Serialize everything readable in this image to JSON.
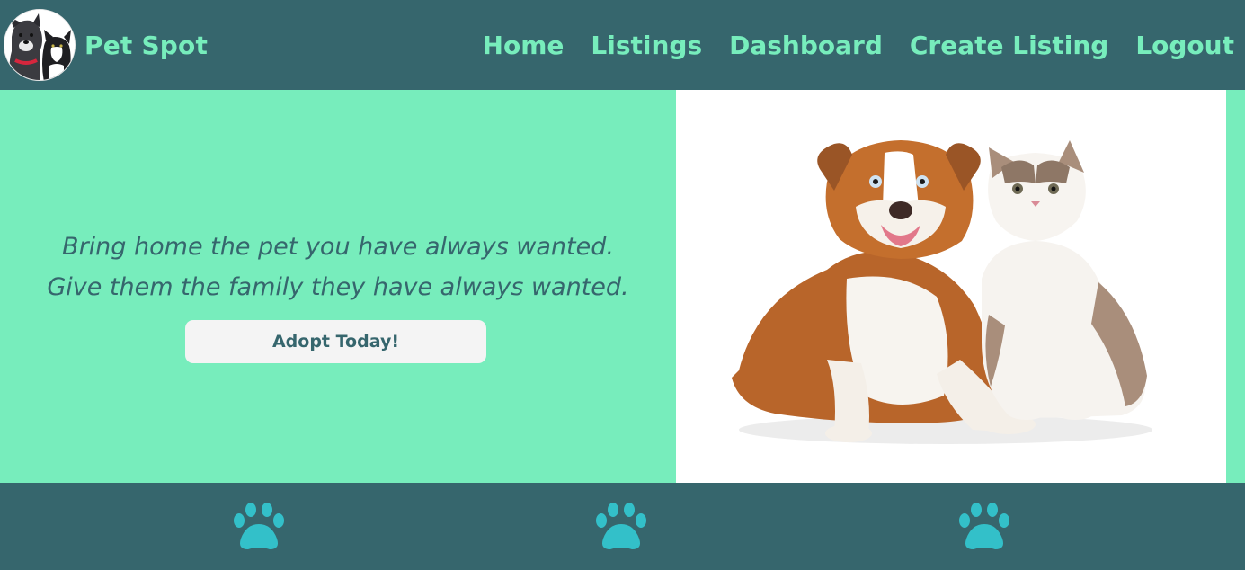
{
  "nav": {
    "brand": "Pet Spot",
    "links": [
      {
        "label": "Home"
      },
      {
        "label": "Listings"
      },
      {
        "label": "Dashboard"
      },
      {
        "label": "Create Listing"
      },
      {
        "label": "Logout"
      }
    ]
  },
  "hero": {
    "tagline_line1": "Bring home the pet you have always wanted.",
    "tagline_line2": "Give them the family they have always wanted.",
    "cta_label": "Adopt Today!"
  },
  "footer": {
    "icons": [
      "paw-icon",
      "paw-icon",
      "paw-icon"
    ]
  },
  "colors": {
    "primary_dark": "#36666d",
    "accent_mint": "#77edbc",
    "paw": "#33c0c9",
    "button_bg": "#f4f4f4"
  }
}
